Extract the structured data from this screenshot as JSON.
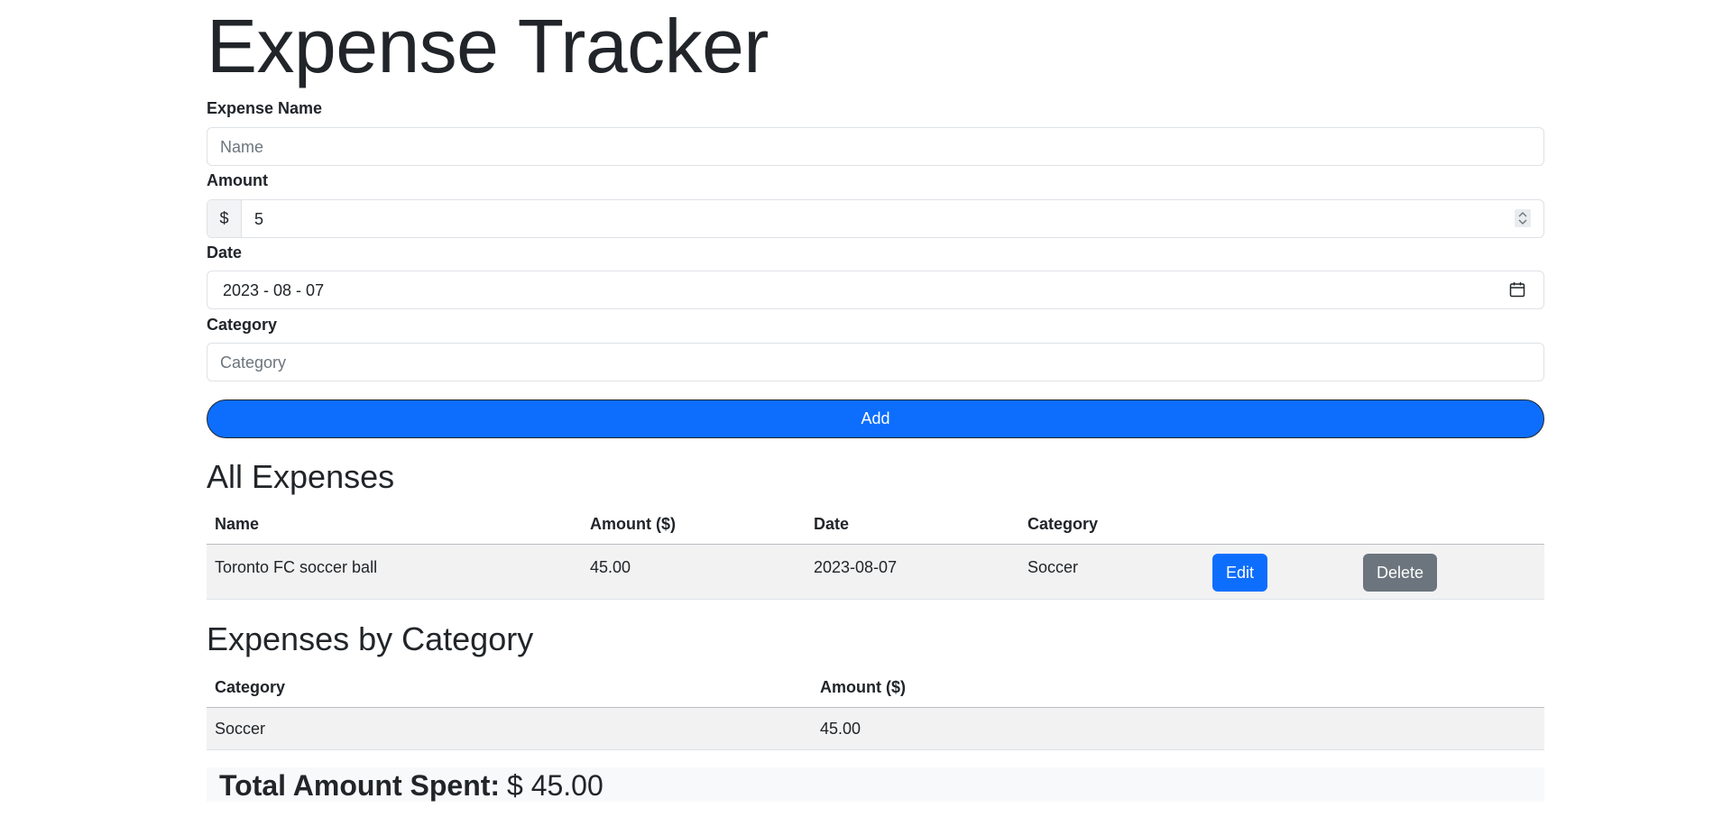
{
  "page": {
    "title": "Expense Tracker"
  },
  "form": {
    "name_label": "Expense Name",
    "name_placeholder": "Name",
    "amount_label": "Amount",
    "currency_prefix": "$",
    "amount_value": "5",
    "date_label": "Date",
    "date_value": "2023 - 08 - 07",
    "category_label": "Category",
    "category_placeholder": "Category",
    "add_label": "Add"
  },
  "all_expenses": {
    "title": "All Expenses",
    "columns": [
      "Name",
      "Amount ($)",
      "Date",
      "Category"
    ],
    "rows": [
      {
        "name": "Toronto FC soccer ball",
        "amount": "45.00",
        "date": "2023-08-07",
        "category": "Soccer",
        "edit_label": "Edit",
        "delete_label": "Delete"
      }
    ]
  },
  "by_category": {
    "title": "Expenses by Category",
    "columns": [
      "Category",
      "Amount ($)"
    ],
    "rows": [
      {
        "category": "Soccer",
        "amount": "45.00"
      }
    ]
  },
  "total": {
    "label": "Total Amount Spent:",
    "value": "$ 45.00"
  },
  "colors": {
    "primary": "#0d6efd",
    "secondary": "#6c757d",
    "text": "#212529",
    "striped_row": "#f2f2f2"
  },
  "icons": {
    "amount_spinner": "spinner-arrows-icon",
    "date_picker": "calendar-icon"
  }
}
